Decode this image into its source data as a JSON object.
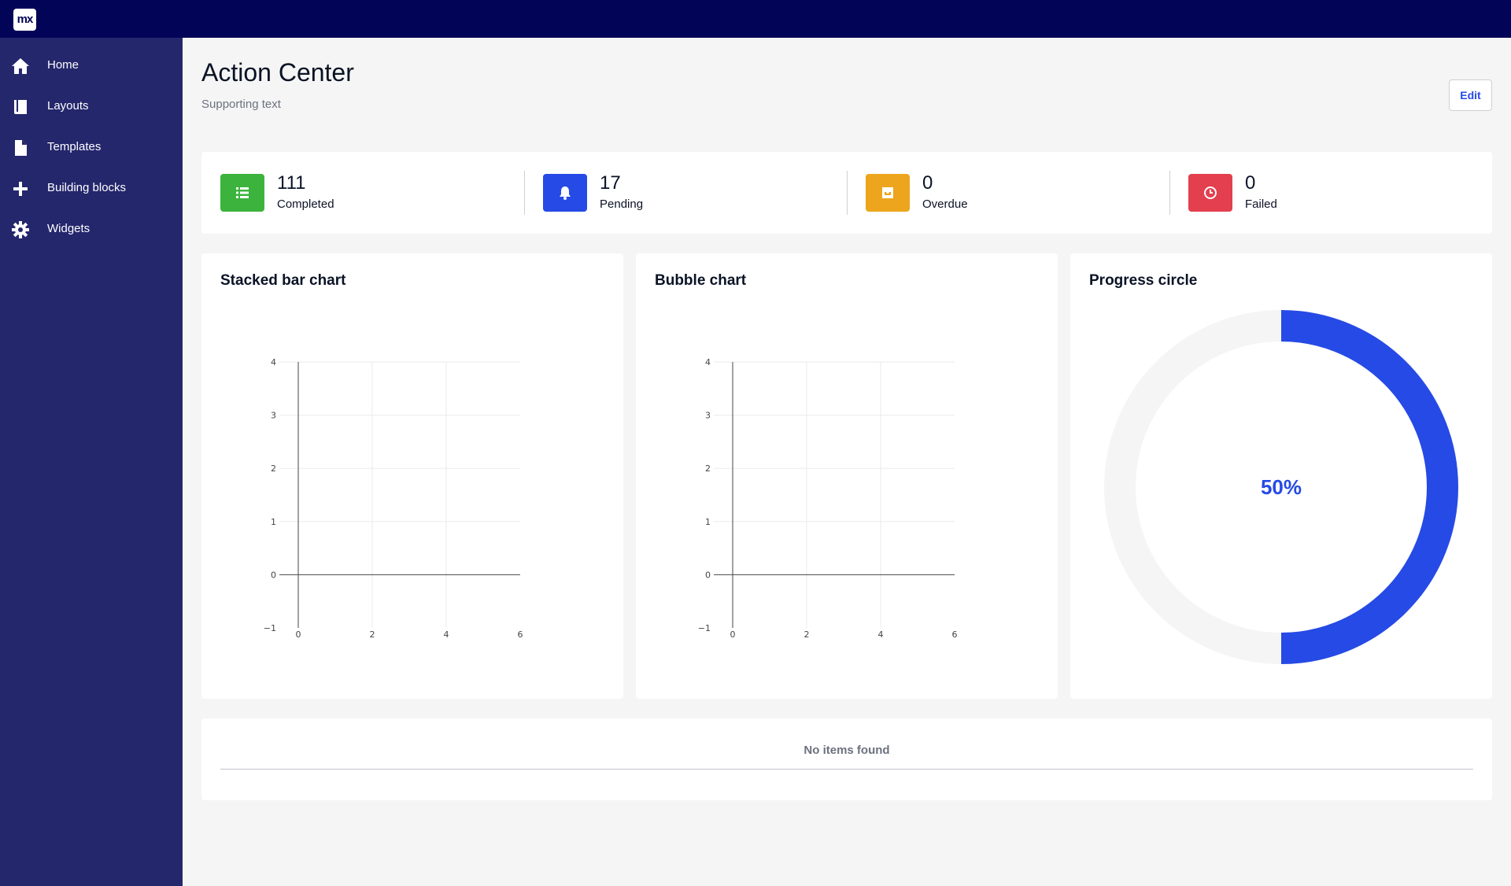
{
  "app": {
    "logo_text": "mx"
  },
  "sidebar": {
    "items": [
      {
        "label": "Home",
        "icon": "home-icon"
      },
      {
        "label": "Layouts",
        "icon": "book-icon"
      },
      {
        "label": "Templates",
        "icon": "document-icon"
      },
      {
        "label": "Building blocks",
        "icon": "plus-icon"
      },
      {
        "label": "Widgets",
        "icon": "gear-icon"
      }
    ]
  },
  "header": {
    "title": "Action Center",
    "subtitle": "Supporting text",
    "edit_label": "Edit"
  },
  "stats": [
    {
      "value": "111",
      "label": "Completed",
      "color": "#3cb33d",
      "icon": "list-icon"
    },
    {
      "value": "17",
      "label": "Pending",
      "color": "#264ae5",
      "icon": "bell-icon"
    },
    {
      "value": "0",
      "label": "Overdue",
      "color": "#eca51c",
      "icon": "inbox-icon"
    },
    {
      "value": "0",
      "label": "Failed",
      "color": "#e33f4e",
      "icon": "clock-icon"
    }
  ],
  "cards": {
    "stacked_title": "Stacked bar chart",
    "bubble_title": "Bubble chart",
    "progress_title": "Progress circle"
  },
  "chart_data": [
    {
      "type": "bar",
      "xlim": [
        -1,
        6
      ],
      "ylim": [
        -1,
        4
      ],
      "x_ticks": [
        "0",
        "2",
        "4",
        "6"
      ],
      "y_ticks": [
        "4",
        "3",
        "2",
        "1",
        "0",
        "−1"
      ],
      "series": []
    },
    {
      "type": "scatter",
      "xlim": [
        -1,
        6
      ],
      "ylim": [
        -1,
        4
      ],
      "x_ticks": [
        "0",
        "2",
        "4",
        "6"
      ],
      "y_ticks": [
        "4",
        "3",
        "2",
        "1",
        "0",
        "−1"
      ],
      "series": []
    }
  ],
  "progress": {
    "value": 0.5,
    "label": "50%",
    "color": "#264ae5",
    "track_color": "#f5f5f5"
  },
  "list": {
    "empty_text": "No items found"
  }
}
